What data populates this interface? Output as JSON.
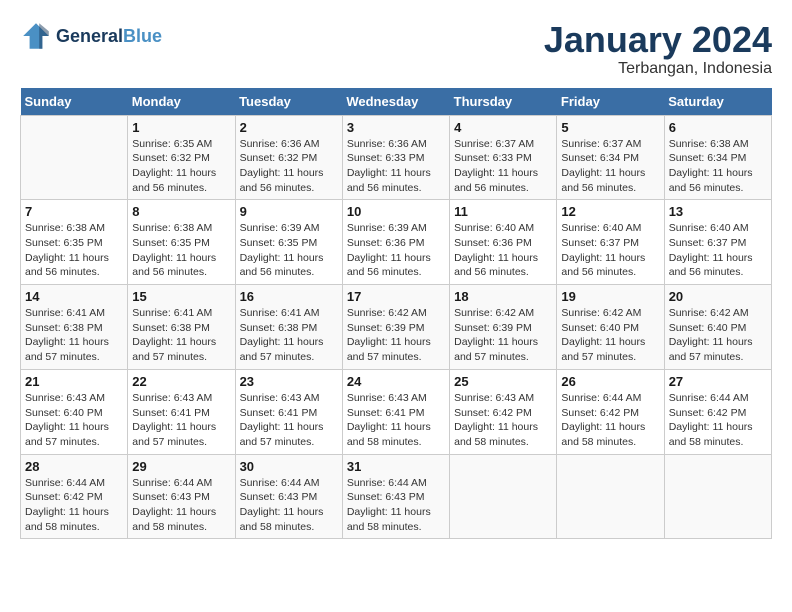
{
  "header": {
    "logo_line1": "General",
    "logo_line2": "Blue",
    "month_title": "January 2024",
    "location": "Terbangan, Indonesia"
  },
  "days_of_week": [
    "Sunday",
    "Monday",
    "Tuesday",
    "Wednesday",
    "Thursday",
    "Friday",
    "Saturday"
  ],
  "weeks": [
    [
      {
        "num": "",
        "sunrise": "",
        "sunset": "",
        "daylight": ""
      },
      {
        "num": "1",
        "sunrise": "Sunrise: 6:35 AM",
        "sunset": "Sunset: 6:32 PM",
        "daylight": "Daylight: 11 hours and 56 minutes."
      },
      {
        "num": "2",
        "sunrise": "Sunrise: 6:36 AM",
        "sunset": "Sunset: 6:32 PM",
        "daylight": "Daylight: 11 hours and 56 minutes."
      },
      {
        "num": "3",
        "sunrise": "Sunrise: 6:36 AM",
        "sunset": "Sunset: 6:33 PM",
        "daylight": "Daylight: 11 hours and 56 minutes."
      },
      {
        "num": "4",
        "sunrise": "Sunrise: 6:37 AM",
        "sunset": "Sunset: 6:33 PM",
        "daylight": "Daylight: 11 hours and 56 minutes."
      },
      {
        "num": "5",
        "sunrise": "Sunrise: 6:37 AM",
        "sunset": "Sunset: 6:34 PM",
        "daylight": "Daylight: 11 hours and 56 minutes."
      },
      {
        "num": "6",
        "sunrise": "Sunrise: 6:38 AM",
        "sunset": "Sunset: 6:34 PM",
        "daylight": "Daylight: 11 hours and 56 minutes."
      }
    ],
    [
      {
        "num": "7",
        "sunrise": "Sunrise: 6:38 AM",
        "sunset": "Sunset: 6:35 PM",
        "daylight": "Daylight: 11 hours and 56 minutes."
      },
      {
        "num": "8",
        "sunrise": "Sunrise: 6:38 AM",
        "sunset": "Sunset: 6:35 PM",
        "daylight": "Daylight: 11 hours and 56 minutes."
      },
      {
        "num": "9",
        "sunrise": "Sunrise: 6:39 AM",
        "sunset": "Sunset: 6:35 PM",
        "daylight": "Daylight: 11 hours and 56 minutes."
      },
      {
        "num": "10",
        "sunrise": "Sunrise: 6:39 AM",
        "sunset": "Sunset: 6:36 PM",
        "daylight": "Daylight: 11 hours and 56 minutes."
      },
      {
        "num": "11",
        "sunrise": "Sunrise: 6:40 AM",
        "sunset": "Sunset: 6:36 PM",
        "daylight": "Daylight: 11 hours and 56 minutes."
      },
      {
        "num": "12",
        "sunrise": "Sunrise: 6:40 AM",
        "sunset": "Sunset: 6:37 PM",
        "daylight": "Daylight: 11 hours and 56 minutes."
      },
      {
        "num": "13",
        "sunrise": "Sunrise: 6:40 AM",
        "sunset": "Sunset: 6:37 PM",
        "daylight": "Daylight: 11 hours and 56 minutes."
      }
    ],
    [
      {
        "num": "14",
        "sunrise": "Sunrise: 6:41 AM",
        "sunset": "Sunset: 6:38 PM",
        "daylight": "Daylight: 11 hours and 57 minutes."
      },
      {
        "num": "15",
        "sunrise": "Sunrise: 6:41 AM",
        "sunset": "Sunset: 6:38 PM",
        "daylight": "Daylight: 11 hours and 57 minutes."
      },
      {
        "num": "16",
        "sunrise": "Sunrise: 6:41 AM",
        "sunset": "Sunset: 6:38 PM",
        "daylight": "Daylight: 11 hours and 57 minutes."
      },
      {
        "num": "17",
        "sunrise": "Sunrise: 6:42 AM",
        "sunset": "Sunset: 6:39 PM",
        "daylight": "Daylight: 11 hours and 57 minutes."
      },
      {
        "num": "18",
        "sunrise": "Sunrise: 6:42 AM",
        "sunset": "Sunset: 6:39 PM",
        "daylight": "Daylight: 11 hours and 57 minutes."
      },
      {
        "num": "19",
        "sunrise": "Sunrise: 6:42 AM",
        "sunset": "Sunset: 6:40 PM",
        "daylight": "Daylight: 11 hours and 57 minutes."
      },
      {
        "num": "20",
        "sunrise": "Sunrise: 6:42 AM",
        "sunset": "Sunset: 6:40 PM",
        "daylight": "Daylight: 11 hours and 57 minutes."
      }
    ],
    [
      {
        "num": "21",
        "sunrise": "Sunrise: 6:43 AM",
        "sunset": "Sunset: 6:40 PM",
        "daylight": "Daylight: 11 hours and 57 minutes."
      },
      {
        "num": "22",
        "sunrise": "Sunrise: 6:43 AM",
        "sunset": "Sunset: 6:41 PM",
        "daylight": "Daylight: 11 hours and 57 minutes."
      },
      {
        "num": "23",
        "sunrise": "Sunrise: 6:43 AM",
        "sunset": "Sunset: 6:41 PM",
        "daylight": "Daylight: 11 hours and 57 minutes."
      },
      {
        "num": "24",
        "sunrise": "Sunrise: 6:43 AM",
        "sunset": "Sunset: 6:41 PM",
        "daylight": "Daylight: 11 hours and 58 minutes."
      },
      {
        "num": "25",
        "sunrise": "Sunrise: 6:43 AM",
        "sunset": "Sunset: 6:42 PM",
        "daylight": "Daylight: 11 hours and 58 minutes."
      },
      {
        "num": "26",
        "sunrise": "Sunrise: 6:44 AM",
        "sunset": "Sunset: 6:42 PM",
        "daylight": "Daylight: 11 hours and 58 minutes."
      },
      {
        "num": "27",
        "sunrise": "Sunrise: 6:44 AM",
        "sunset": "Sunset: 6:42 PM",
        "daylight": "Daylight: 11 hours and 58 minutes."
      }
    ],
    [
      {
        "num": "28",
        "sunrise": "Sunrise: 6:44 AM",
        "sunset": "Sunset: 6:42 PM",
        "daylight": "Daylight: 11 hours and 58 minutes."
      },
      {
        "num": "29",
        "sunrise": "Sunrise: 6:44 AM",
        "sunset": "Sunset: 6:43 PM",
        "daylight": "Daylight: 11 hours and 58 minutes."
      },
      {
        "num": "30",
        "sunrise": "Sunrise: 6:44 AM",
        "sunset": "Sunset: 6:43 PM",
        "daylight": "Daylight: 11 hours and 58 minutes."
      },
      {
        "num": "31",
        "sunrise": "Sunrise: 6:44 AM",
        "sunset": "Sunset: 6:43 PM",
        "daylight": "Daylight: 11 hours and 58 minutes."
      },
      {
        "num": "",
        "sunrise": "",
        "sunset": "",
        "daylight": ""
      },
      {
        "num": "",
        "sunrise": "",
        "sunset": "",
        "daylight": ""
      },
      {
        "num": "",
        "sunrise": "",
        "sunset": "",
        "daylight": ""
      }
    ]
  ]
}
